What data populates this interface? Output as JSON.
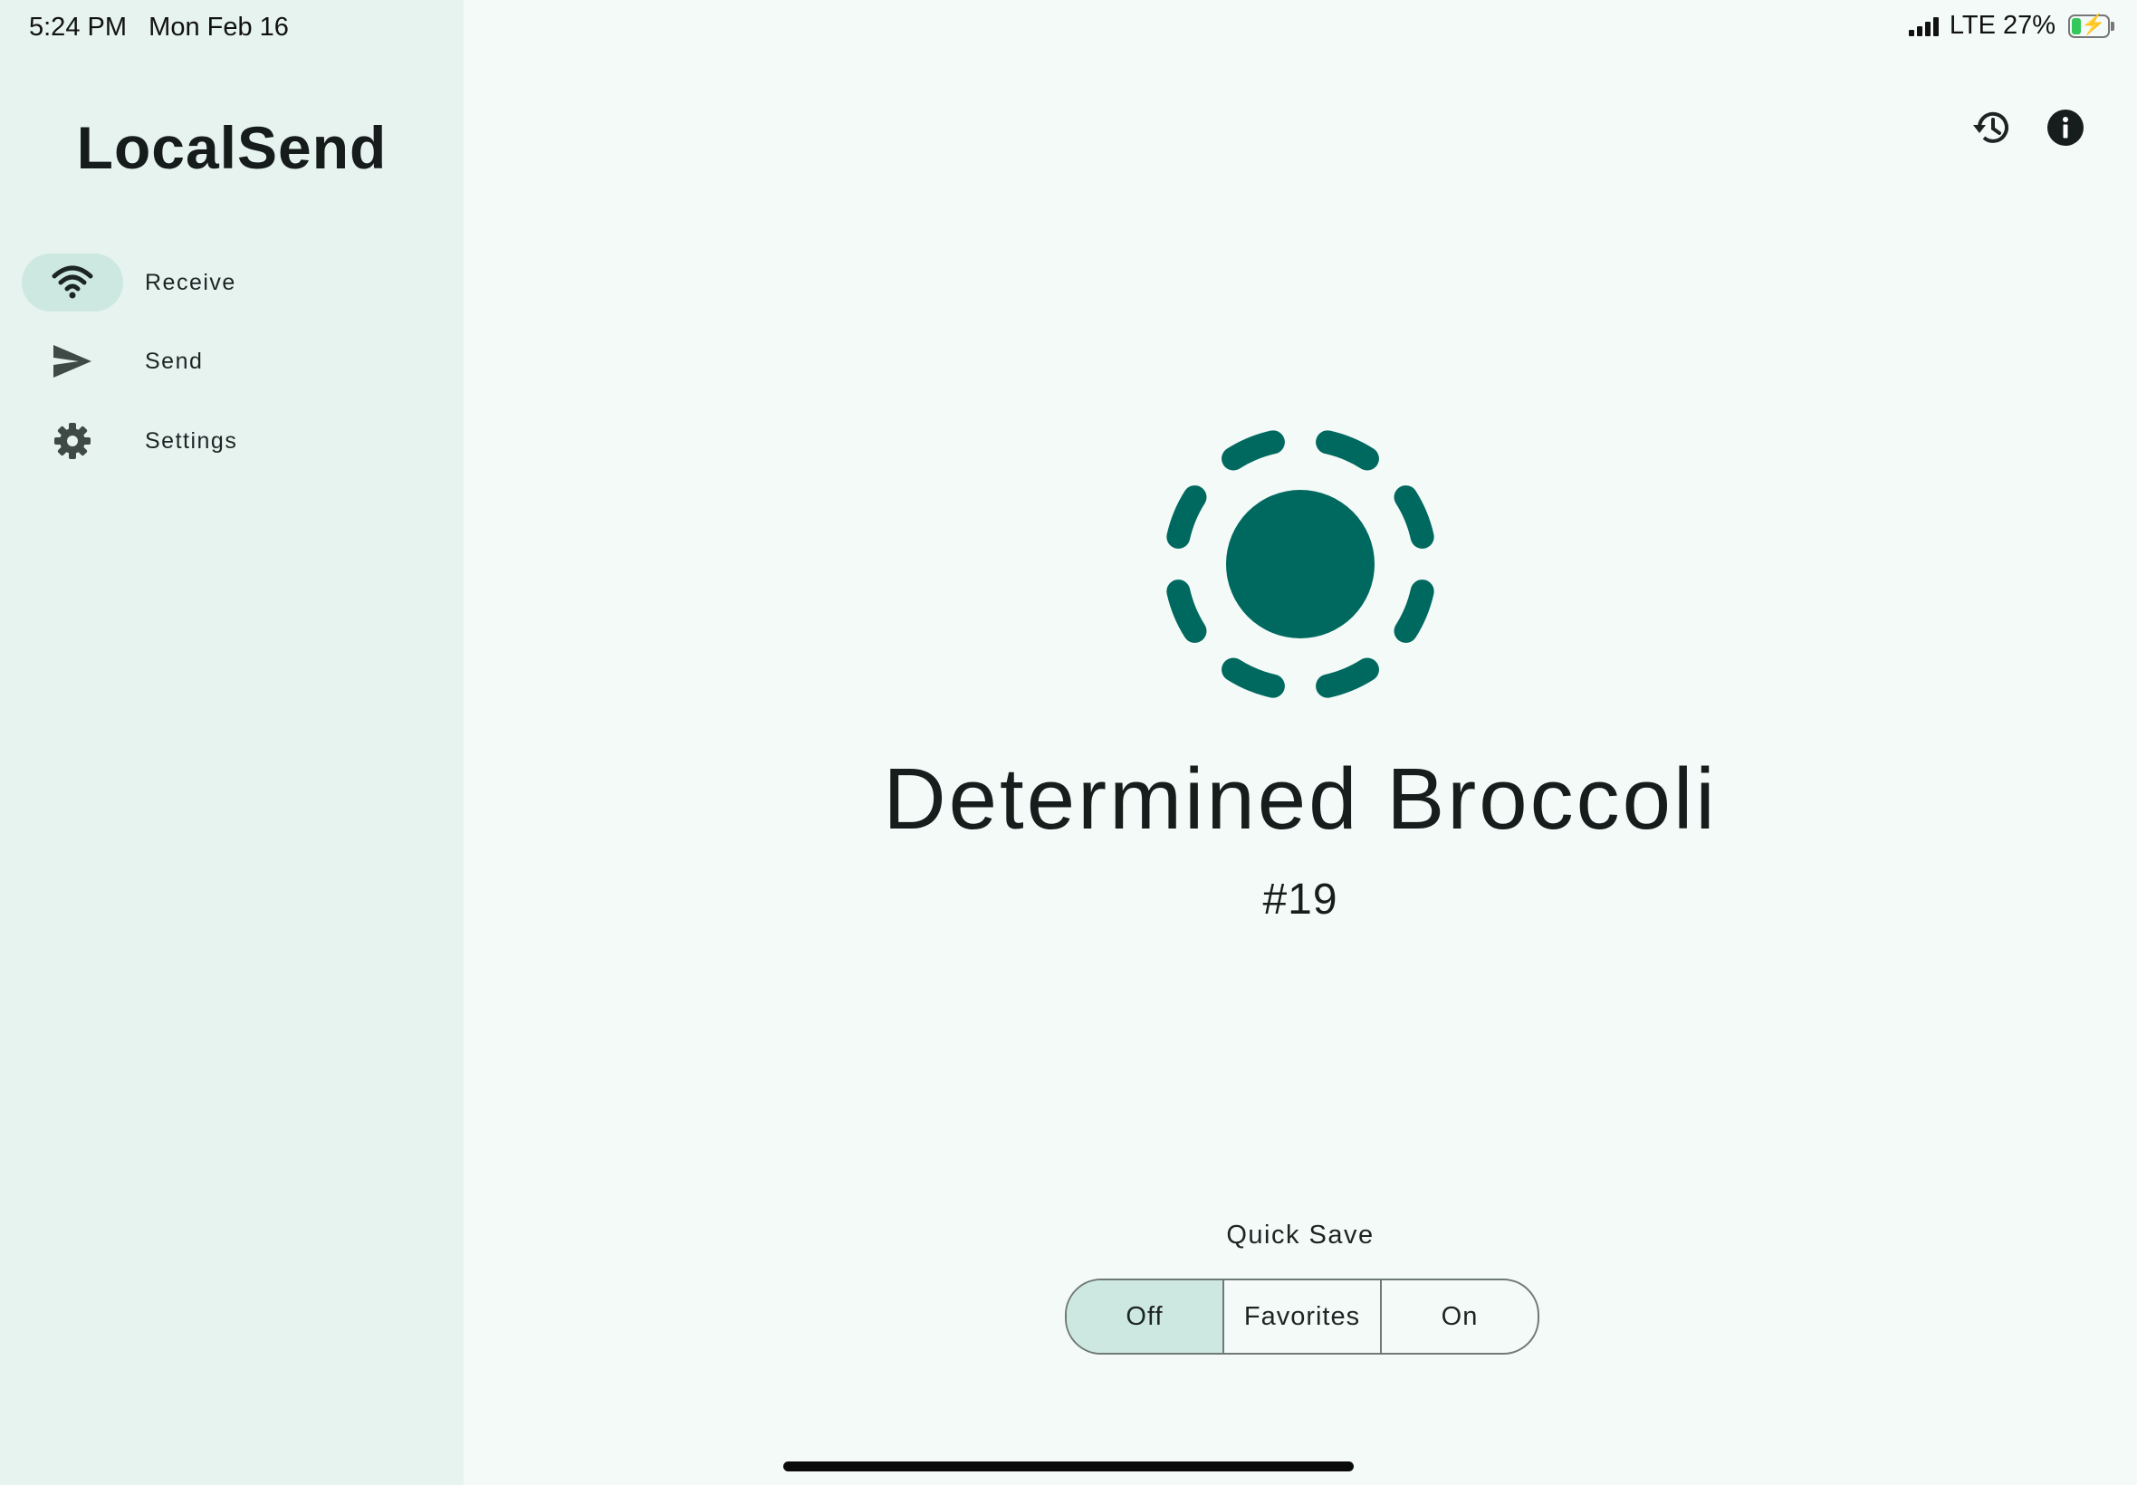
{
  "status_bar": {
    "time": "5:24 PM",
    "date": "Mon Feb 16",
    "network": "LTE",
    "battery": "27%",
    "battery_level": 0.27
  },
  "app": {
    "title": "LocalSend"
  },
  "nav": [
    {
      "label": "Receive",
      "icon": "wifi-icon",
      "active": true
    },
    {
      "label": "Send",
      "icon": "send-icon",
      "active": false
    },
    {
      "label": "Settings",
      "icon": "gear-icon",
      "active": false
    }
  ],
  "header": {
    "history_icon": "history-icon",
    "info_icon": "info-icon"
  },
  "receive": {
    "device_name": "Determined Broccoli",
    "device_id": "#19",
    "quick_save": {
      "label": "Quick Save",
      "options": [
        "Off",
        "Favorites",
        "On"
      ],
      "selected": "Off"
    }
  },
  "colors": {
    "accent": "#00695f",
    "sidebar_bg": "#e6f3ef",
    "main_bg": "#f3faf8",
    "selection_bg": "#cde8e1"
  }
}
